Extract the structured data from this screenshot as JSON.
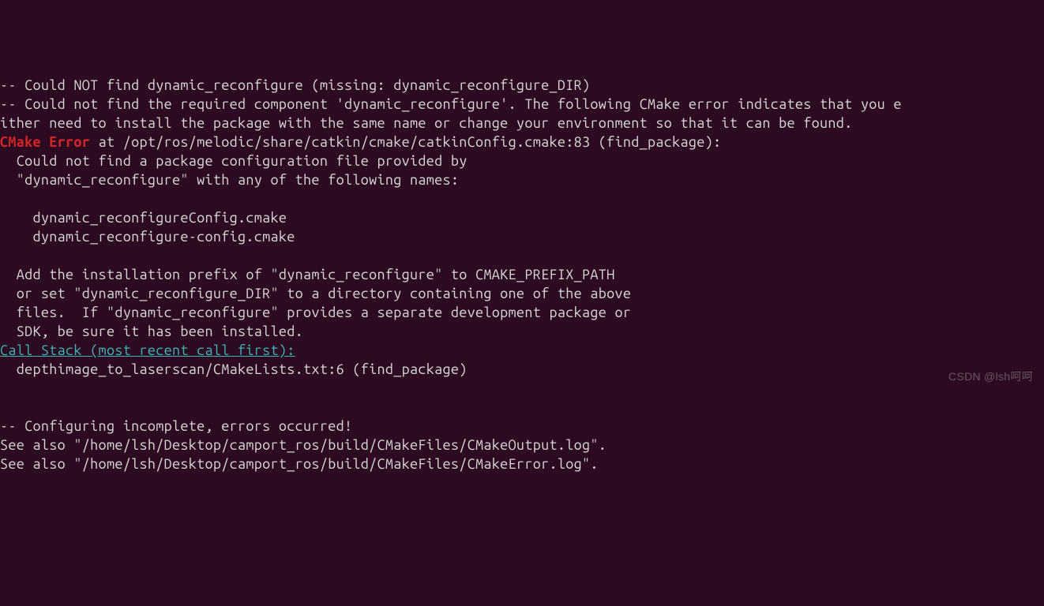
{
  "terminal": {
    "line1": "-- Could NOT find dynamic_reconfigure (missing: dynamic_reconfigure_DIR)",
    "line2": "-- Could not find the required component 'dynamic_reconfigure'. The following CMake error indicates that you e",
    "line3": "ither need to install the package with the same name or change your environment so that it can be found.",
    "error_label": "CMake Error",
    "error_location": " at /opt/ros/melodic/share/catkin/cmake/catkinConfig.cmake:83 (find_package):",
    "line5": "  Could not find a package configuration file provided by",
    "line6": "  \"dynamic_reconfigure\" with any of the following names:",
    "line7": "",
    "line8": "    dynamic_reconfigureConfig.cmake",
    "line9": "    dynamic_reconfigure-config.cmake",
    "line10": "",
    "line11": "  Add the installation prefix of \"dynamic_reconfigure\" to CMAKE_PREFIX_PATH",
    "line12": "  or set \"dynamic_reconfigure_DIR\" to a directory containing one of the above",
    "line13": "  files.  If \"dynamic_reconfigure\" provides a separate development package or",
    "line14": "  SDK, be sure it has been installed.",
    "call_stack_label": "Call Stack (most recent call first):",
    "line16": "  depthimage_to_laserscan/CMakeLists.txt:6 (find_package)",
    "line17": "",
    "line18": "",
    "line19": "-- Configuring incomplete, errors occurred!",
    "line20": "See also \"/home/lsh/Desktop/camport_ros/build/CMakeFiles/CMakeOutput.log\".",
    "line21": "See also \"/home/lsh/Desktop/camport_ros/build/CMakeFiles/CMakeError.log\"."
  },
  "watermark": "CSDN @lsh呵呵"
}
